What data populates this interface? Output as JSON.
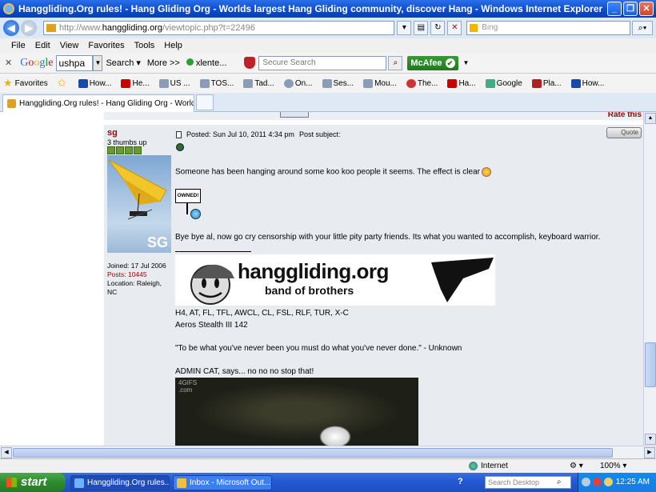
{
  "window": {
    "title": "Hanggliding.Org rules! - Hang Gliding Org - Worlds largest Hang Gliding community, discover Hang - Windows Internet Explorer"
  },
  "address": {
    "prefix": "http://www.",
    "host": "hanggliding.org",
    "path": "/viewtopic.php?t=22496",
    "search_placeholder": "Bing"
  },
  "menu": [
    "File",
    "Edit",
    "View",
    "Favorites",
    "Tools",
    "Help"
  ],
  "google_toolbar": {
    "search_value": "ushpa",
    "search_label": "Search",
    "more_label": "More >>",
    "xlente_label": "xlente...",
    "secure_search_placeholder": "Secure Search",
    "mcafee_label": "McAfee"
  },
  "favorites": {
    "label": "Favorites",
    "items": [
      "How...",
      "He...",
      "US ...",
      "TOS...",
      "Tad...",
      "On...",
      "Ses...",
      "Mou...",
      "The...",
      "Ha...",
      "Google",
      "Pla...",
      "How..."
    ]
  },
  "tab": {
    "label": "Hanggliding.Org rules! - Hang Gliding Org - Worlds larg..."
  },
  "post": {
    "rate_label": "Rate this",
    "username": "sg",
    "rank": "3 thumbs up",
    "avatar_initials": "SG",
    "joined": "Joined: 17 Jul 2006",
    "posts": "Posts: 10445",
    "location": "Location: Raleigh, NC",
    "posted_info": "Posted: Sun Jul 10, 2011 4:34 pm",
    "subject_label": "Post subject:",
    "quote_label": "Quote",
    "text1": "Someone has been hanging around some koo koo people it seems. The effect is clear",
    "owned_sign": "OWNED!",
    "text2": "Bye bye al, now go cry censorship with your little pity party friends. Its what you wanted to accomplish, keyboard warrior.",
    "banner_title": "hanggliding.org",
    "banner_subtitle": "band of brothers",
    "sig1": "H4, AT, FL, TFL, AWCL, CL, FSL, RLF, TUR, X-C",
    "sig2": "Aeros Stealth III 142",
    "sig3": "\"To be what you've never been you must do what you've never done.\" - Unknown",
    "sig4": "ADMIN CAT, says... no no no stop that!",
    "gif_label": "4GIFS\n.com"
  },
  "status": {
    "zone": "Internet",
    "zoom": "100%"
  },
  "taskbar": {
    "start_label": "start",
    "item1": "Hanggliding.Org rules...",
    "item2": "Inbox - Microsoft Out...",
    "help": "?",
    "search_desktop": "Search Desktop",
    "clock": "12:25 AM"
  }
}
